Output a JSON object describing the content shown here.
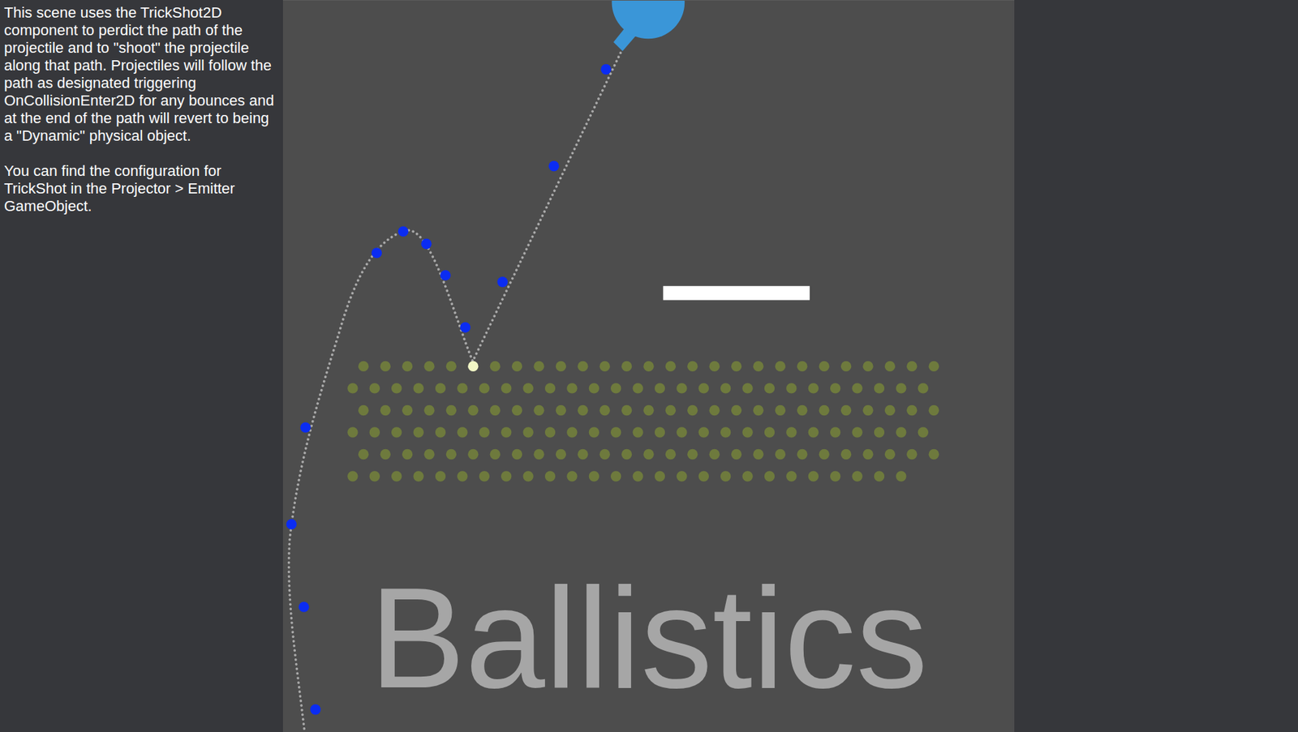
{
  "description": {
    "paragraphs": [
      [
        "This scene uses the TrickShot2D",
        "component to perdict the path of the",
        "projectile and to \"shoot\" the projectile",
        "along that path. Projectiles will follow the",
        "path as designated triggering",
        "OnCollisionEnter2D for any bounces and",
        "at the end of the path will revert to being",
        "a \"Dynamic\" physical object."
      ],
      [
        "You can find the configuration for",
        "TrickShot in the Projector > Emitter",
        "GameObject."
      ]
    ]
  },
  "scene": {
    "title": "Ballistics",
    "peg_rows": [
      {
        "count": 27,
        "hit": [
          5
        ]
      },
      {
        "count": 27,
        "hit": []
      },
      {
        "count": 27,
        "hit": []
      },
      {
        "count": 27,
        "hit": []
      },
      {
        "count": 27,
        "hit": []
      },
      {
        "count": 26,
        "hit": []
      }
    ]
  }
}
